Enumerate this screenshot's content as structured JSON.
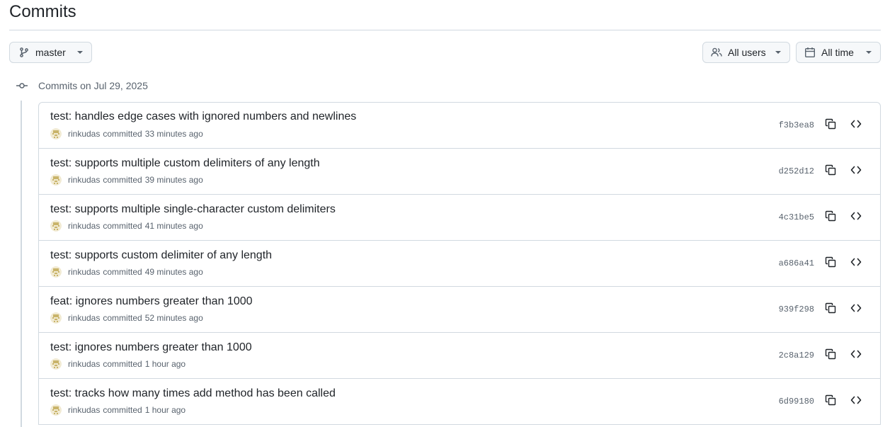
{
  "page": {
    "title": "Commits"
  },
  "toolbar": {
    "branch_label": "master",
    "users_label": "All users",
    "time_label": "All time"
  },
  "group": {
    "heading": "Commits on Jul 29, 2025"
  },
  "icons": {
    "branch": "git-branch-icon",
    "users": "people-icon",
    "time": "calendar-icon",
    "copy": "copy-icon",
    "browse": "code-icon",
    "commit": "git-commit-icon"
  },
  "colors": {
    "text": "#1f2328",
    "muted": "#59636e",
    "border": "#d1d9e0",
    "button_bg": "#f6f8fa"
  },
  "commits": [
    {
      "message": "test: handles edge cases with ignored numbers and newlines",
      "author": "rinkudas",
      "action": "committed",
      "time": "33 minutes ago",
      "sha": "f3b3ea8"
    },
    {
      "message": "test: supports multiple custom delimiters of any length",
      "author": "rinkudas",
      "action": "committed",
      "time": "39 minutes ago",
      "sha": "d252d12"
    },
    {
      "message": "test: supports multiple single-character custom delimiters",
      "author": "rinkudas",
      "action": "committed",
      "time": "41 minutes ago",
      "sha": "4c31be5"
    },
    {
      "message": "test: supports custom delimiter of any length",
      "author": "rinkudas",
      "action": "committed",
      "time": "49 minutes ago",
      "sha": "a686a41"
    },
    {
      "message": "feat: ignores numbers greater than 1000",
      "author": "rinkudas",
      "action": "committed",
      "time": "52 minutes ago",
      "sha": "939f298"
    },
    {
      "message": "test: ignores numbers greater than 1000",
      "author": "rinkudas",
      "action": "committed",
      "time": "1 hour ago",
      "sha": "2c8a129"
    },
    {
      "message": "test: tracks how many times add method has been called",
      "author": "rinkudas",
      "action": "committed",
      "time": "1 hour ago",
      "sha": "6d99180"
    }
  ]
}
